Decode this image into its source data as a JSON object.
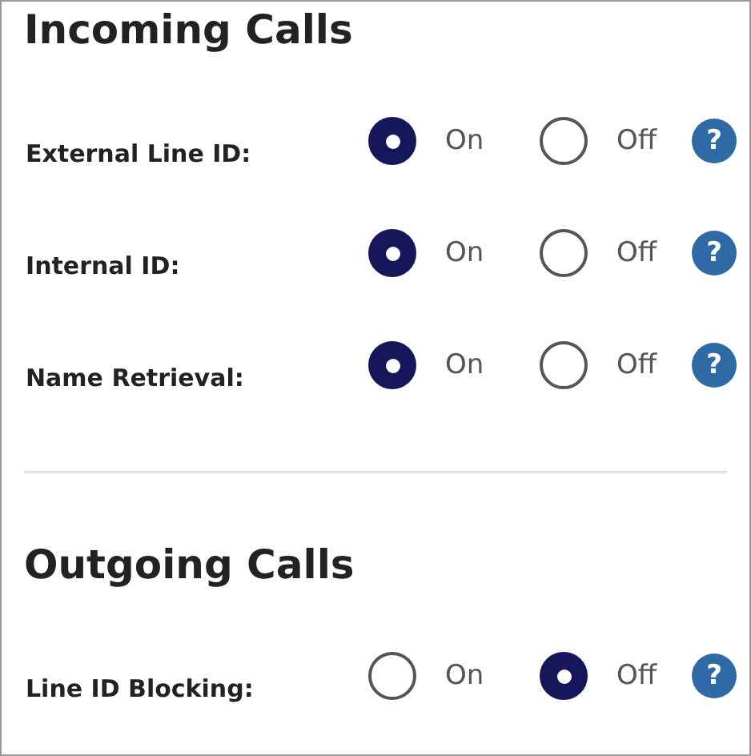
{
  "sections": [
    {
      "title": "Incoming Calls",
      "settings": [
        {
          "label": "External Line ID:",
          "options": [
            {
              "label": "On",
              "selected": true
            },
            {
              "label": "Off",
              "selected": false
            }
          ],
          "help": "?"
        },
        {
          "label": "Internal ID:",
          "options": [
            {
              "label": "On",
              "selected": true
            },
            {
              "label": "Off",
              "selected": false
            }
          ],
          "help": "?"
        },
        {
          "label": "Name Retrieval:",
          "options": [
            {
              "label": "On",
              "selected": true
            },
            {
              "label": "Off",
              "selected": false
            }
          ],
          "help": "?"
        }
      ]
    },
    {
      "title": "Outgoing Calls",
      "settings": [
        {
          "label": "Line ID Blocking:",
          "options": [
            {
              "label": "On",
              "selected": false
            },
            {
              "label": "Off",
              "selected": true
            }
          ],
          "help": "?"
        }
      ]
    }
  ]
}
